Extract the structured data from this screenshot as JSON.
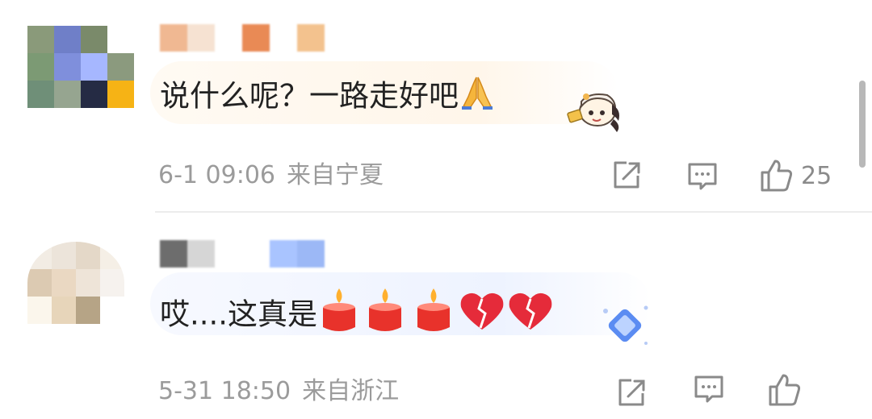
{
  "comments": [
    {
      "text": "说什么呢？一路走好吧",
      "time": "6-1 09:06",
      "location": "来自宁夏",
      "likes": "25",
      "avatar_pixels": [
        "#8a9a7a",
        "#6f7fc8",
        "#7a8a6a",
        "#ffffff",
        "#7c9a74",
        "#7f8fdc",
        "#a6b7ff",
        "#8b9a7e",
        "#6f8f78",
        "#96a590",
        "#252b44",
        "#f6b315"
      ],
      "username_pixels": [
        "#f0b892",
        "#f6e2d2",
        "#ffffff",
        "#e98a55",
        "#ffffff",
        "#f3c28e"
      ]
    },
    {
      "text": "哎....这真是",
      "time": "5-31 18:50",
      "location": "来自浙江",
      "avatar_pixels": [
        "#f2ece4",
        "#ece4da",
        "#e4d8c8",
        "#f5efe6",
        "#dccab2",
        "#ead8c2",
        "#eee4d8",
        "#f6f2ee",
        "#fbf6ec",
        "#e7d5ba",
        "#b6a486",
        "#ffffff"
      ],
      "username_pixels": [
        "#6d6d6d",
        "#d6d6d6",
        "#ffffff",
        "#ffffff",
        "#a9c4ff",
        "#9cb8f6"
      ]
    }
  ],
  "icons": {
    "share": "share-icon",
    "reply": "comment-icon",
    "like": "thumbs-up-icon",
    "pray": "folded-hands-emoji",
    "candle": "candle-emoji",
    "broken_heart": "broken-heart-emoji",
    "sticker": "anime-character-sticker",
    "badge": "diamond-badge-icon"
  },
  "colors": {
    "text": "#222222",
    "meta": "#9b9b9b",
    "icon": "#8a8a8a"
  }
}
